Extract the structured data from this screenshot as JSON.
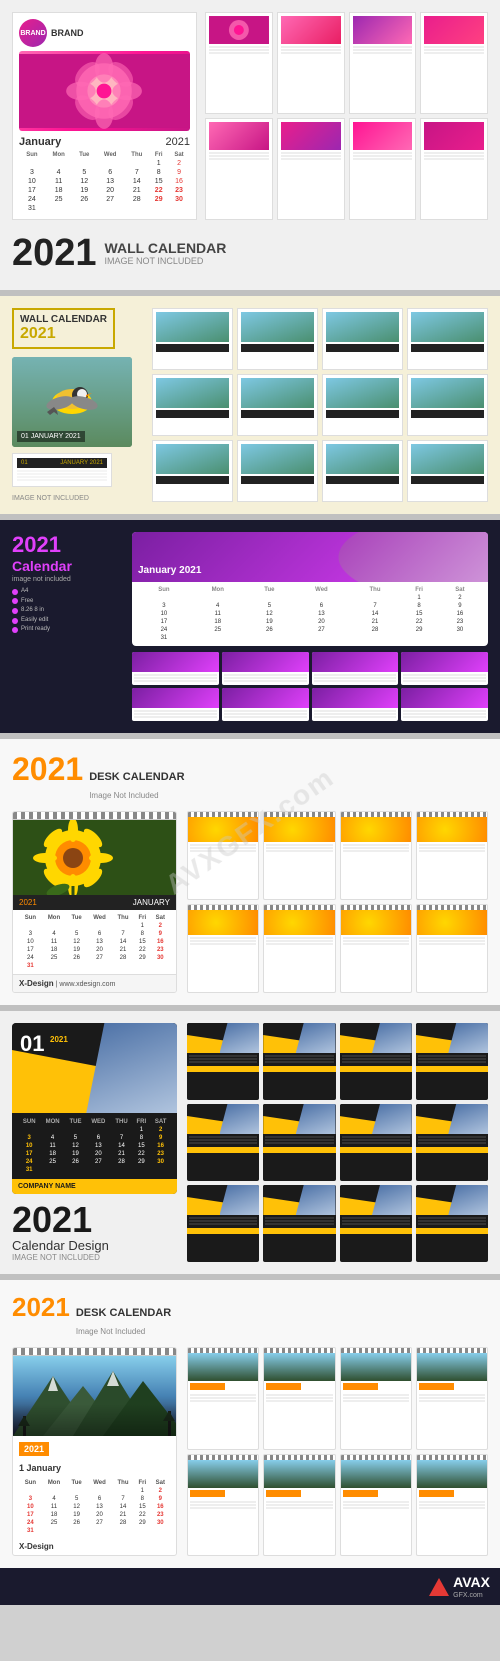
{
  "sec1": {
    "brand": "BRAND",
    "month": "January",
    "year": "2021",
    "year_big": "2021",
    "wall_calendar": "WALL CALENDAR",
    "not_included": "IMAGE NOT INCLUDED",
    "days_header": [
      "SUN",
      "MON",
      "TUE",
      "WED",
      "THU",
      "FRI",
      "SAT"
    ],
    "weeks": [
      [
        "",
        "",
        "",
        "",
        "",
        "1",
        "2"
      ],
      [
        "3",
        "4",
        "5",
        "6",
        "7",
        "8",
        "9"
      ],
      [
        "10",
        "11",
        "12",
        "13",
        "14",
        "15",
        "16"
      ],
      [
        "17",
        "18",
        "19",
        "20",
        "21",
        "22",
        "23"
      ],
      [
        "24",
        "25",
        "26",
        "27",
        "28",
        "29",
        "30"
      ],
      [
        "31",
        "",
        "",
        "",
        "",
        "",
        ""
      ]
    ]
  },
  "sec2": {
    "wall_calendar": "WALL CALENDAR",
    "year": "2021",
    "month_label": "01 JANUARY 2021",
    "not_included": "IMAGE NOT INCLUDED"
  },
  "sec3": {
    "title": "2021",
    "calendar": "Calendar",
    "not_included": "image not included",
    "specs": [
      "A4",
      "Free",
      "8.26 8 in",
      "Easily edit",
      "Print ready"
    ],
    "month": "January 2021",
    "days": [
      "Sun",
      "Mon",
      "Tue",
      "Wed",
      "Thu",
      "Fri",
      "Sat"
    ],
    "weeks": [
      [
        "",
        "",
        "",
        "",
        "",
        "1",
        "2"
      ],
      [
        "3",
        "4",
        "5",
        "6",
        "7",
        "8",
        "9"
      ],
      [
        "10",
        "11",
        "12",
        "13",
        "14",
        "15",
        "16"
      ],
      [
        "17",
        "18",
        "19",
        "20",
        "21",
        "22",
        "23"
      ],
      [
        "24",
        "25",
        "26",
        "27",
        "28",
        "29",
        "30"
      ],
      [
        "31",
        "",
        "",
        "",
        "",
        "",
        ""
      ]
    ]
  },
  "sec4": {
    "year": "2021",
    "label": "DESK CALENDAR",
    "not_included": "Image Not Included",
    "month": "JANUARY",
    "month_year": "2021",
    "brand": "X-Design",
    "days": [
      "Sun",
      "Mon",
      "Tue",
      "Wed",
      "Thu",
      "Fri",
      "Sat"
    ],
    "weeks": [
      [
        "",
        "",
        "",
        "",
        "",
        "1",
        "2"
      ],
      [
        "3",
        "4",
        "5",
        "6",
        "7",
        "8",
        "9"
      ],
      [
        "10",
        "11",
        "12",
        "13",
        "14",
        "15",
        "16"
      ],
      [
        "17",
        "18",
        "19",
        "20",
        "21",
        "22",
        "23"
      ],
      [
        "24",
        "25",
        "26",
        "27",
        "28",
        "29",
        "30"
      ],
      [
        "31",
        "",
        "",
        "",
        "",
        "",
        ""
      ]
    ]
  },
  "sec5": {
    "month_num": "01",
    "year": "2021",
    "year_big": "2021",
    "calendar_design": "Calendar Design",
    "not_included": "IMAGE NOT INCLUDED",
    "company": "COMPANY NAME",
    "days": [
      "SUN",
      "MON",
      "TUE",
      "WED",
      "THU",
      "FRI",
      "SAT"
    ],
    "weeks": [
      [
        "",
        "",
        "",
        "",
        "",
        "1",
        "2"
      ],
      [
        "3",
        "4",
        "5",
        "6",
        "7",
        "8",
        "9"
      ],
      [
        "10",
        "11",
        "12",
        "13",
        "14",
        "15",
        "16"
      ],
      [
        "17",
        "18",
        "19",
        "20",
        "21",
        "22",
        "23"
      ],
      [
        "24",
        "25",
        "26",
        "27",
        "28",
        "29",
        "30"
      ],
      [
        "31",
        "",
        "",
        "",
        "",
        "",
        ""
      ]
    ]
  },
  "sec6": {
    "year": "2021",
    "label": "DESK CALENDAR",
    "not_included": "Image Not Included",
    "year_tag": "2021",
    "month": "1 January",
    "brand": "X-Design",
    "days": [
      "Sun",
      "Mon",
      "Tue",
      "Wed",
      "Thu",
      "Fri",
      "Sat"
    ],
    "weeks": [
      [
        "",
        "",
        "",
        "",
        "",
        "1",
        "2"
      ],
      [
        "3",
        "4",
        "5",
        "6",
        "7",
        "8",
        "9"
      ],
      [
        "10",
        "11",
        "12",
        "13",
        "14",
        "15",
        "16"
      ],
      [
        "17",
        "18",
        "19",
        "20",
        "21",
        "22",
        "23"
      ],
      [
        "24",
        "25",
        "26",
        "27",
        "28",
        "29",
        "30"
      ],
      [
        "31",
        "",
        "",
        "",
        "",
        "",
        ""
      ]
    ]
  },
  "watermark": "AVXGFX.com",
  "avax": {
    "name": "AVAX",
    "sub": "GFX.com"
  }
}
